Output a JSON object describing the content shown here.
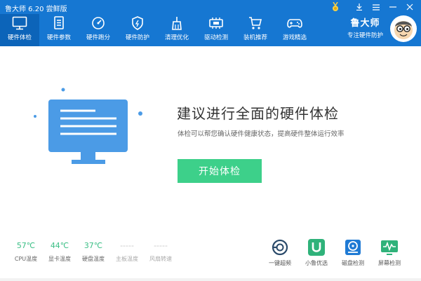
{
  "app": {
    "title": "鲁大师 6.20 尝鲜版",
    "brand_name": "鲁大师",
    "brand_sub": "专注硬件防护"
  },
  "nav": {
    "items": [
      {
        "label": "硬件体检",
        "icon": "monitor-icon",
        "active": true
      },
      {
        "label": "硬件参数",
        "icon": "document-icon"
      },
      {
        "label": "硬件跑分",
        "icon": "speedometer-icon"
      },
      {
        "label": "硬件防护",
        "icon": "shield-icon"
      },
      {
        "label": "清理优化",
        "icon": "broom-icon"
      },
      {
        "label": "驱动检测",
        "icon": "chip-icon"
      },
      {
        "label": "装机推荐",
        "icon": "cart-icon"
      },
      {
        "label": "游戏精选",
        "icon": "gamepad-icon"
      }
    ]
  },
  "main": {
    "headline": "建议进行全面的硬件体检",
    "subline": "体检可以帮您确认硬件健康状态，提高硬件整体运行效率",
    "start_label": "开始体检"
  },
  "stats": [
    {
      "value": "57℃",
      "label": "CPU温度"
    },
    {
      "value": "44℃",
      "label": "显卡温度"
    },
    {
      "value": "37℃",
      "label": "硬盘温度"
    },
    {
      "value": "-----",
      "label": "主板温度"
    },
    {
      "value": "-----",
      "label": "风扇转速"
    }
  ],
  "tools": [
    {
      "label": "一键超频",
      "icon": "overclock-icon"
    },
    {
      "label": "小鲁优选",
      "icon": "u-shop-icon"
    },
    {
      "label": "磁盘检测",
      "icon": "disk-icon"
    },
    {
      "label": "屏幕检测",
      "icon": "screen-test-icon"
    }
  ],
  "colors": {
    "header": "#1677d2",
    "nav_active": "#0c64b9",
    "accent_green": "#3dd08a",
    "monitor_blue": "#4b9be6"
  }
}
